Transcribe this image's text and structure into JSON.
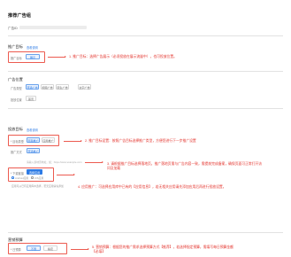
{
  "page": {
    "title": "推荐广告组",
    "id_label": "广告ID"
  },
  "sections": {
    "campaign": {
      "title": "推广目标",
      "link": "查看说明",
      "label": "推广目标",
      "options": [
        "展示"
      ],
      "note": "1. 推广目标：选择广告展示（必须投放在展示流量中），也可投放位置。"
    },
    "placement": {
      "title": "广告位置",
      "rows": [
        {
          "label": "广告类型",
          "options": [
            "普通广告",
            "视频广告",
            "原生广告",
            "文字广告"
          ]
        },
        {
          "label": "投放位置",
          "options": [
            "首页"
          ]
        }
      ]
    },
    "target": {
      "title": "投放目标",
      "link": "查看说明",
      "rows": [
        {
          "label": "* 目标类型",
          "options": [
            "页面推广",
            "应用推广"
          ]
        },
        {
          "label": "推广方式",
          "options": [
            "普通推广"
          ]
        }
      ],
      "note": "2. 推广目标设置：按照广告目标选择推广类型，方便您进行下一步推广设置",
      "landing_hint": "请输入落地页地址，如：https://www.example.com",
      "landing_note": "3. 请根据推广目标选择落地页，推广落地页需与广告内容一致，需提前完成备案，确保页面可正常打开访问及加载",
      "download": {
        "label": "* 下载链接",
        "radio_labels": [
          "Android应用",
          "iOS应用"
        ],
        "button": "选择应用",
        "helper": "应用可从已有应用库中选择，若无应用请先添加"
      },
      "download_note": "4. 应用推广：可选择应用库中已有的【应用信息】，若无相关应用请先添加应用后再进行投放设置。"
    },
    "budget": {
      "title": "营销预算",
      "label": "* 日预算",
      "options": [
        "不限",
        "指定"
      ],
      "note": "5. 营销预算：根据您的推广需求选择预算方式【推荐】，若选择指定预算，需填写每日预算金额【必填】"
    }
  }
}
